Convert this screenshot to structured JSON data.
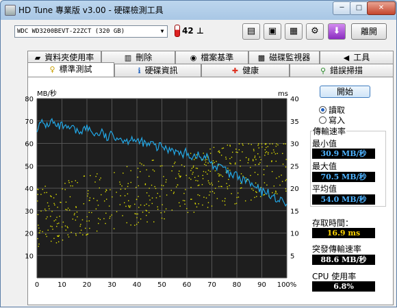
{
  "window": {
    "title": "HD Tune 專業版 v3.00 - 硬碟檢測工具",
    "min_label": "─",
    "max_label": "□",
    "close_label": "✕"
  },
  "toolbar": {
    "drive": "WDC WD3200BEVT-22ZCT (320 GB)",
    "temperature": "42 ⊥",
    "exit_label": "離開",
    "buttons": [
      {
        "icon": "copy-text-icon",
        "glyph": "▤"
      },
      {
        "icon": "copy-screenshot-icon",
        "glyph": "▣"
      },
      {
        "icon": "save-icon",
        "glyph": "▦"
      },
      {
        "icon": "options-icon",
        "glyph": "⚙"
      },
      {
        "icon": "download-icon",
        "glyph": "⬇"
      }
    ]
  },
  "tabs_top": [
    {
      "label": "資料夾使用率",
      "icon": "folder-icon",
      "glyph": "▰"
    },
    {
      "label": "刪除",
      "icon": "trash-icon",
      "glyph": "▥"
    },
    {
      "label": "檔案基準",
      "icon": "file-benchmark-icon",
      "glyph": "◉"
    },
    {
      "label": "磁碟監視器",
      "icon": "disk-monitor-icon",
      "glyph": "▩"
    },
    {
      "label": "工具",
      "icon": "speaker-icon",
      "glyph": "◀"
    }
  ],
  "tabs_bottom": [
    {
      "label": "標準測試",
      "icon": "bulb-icon",
      "glyph": "♀",
      "active": true
    },
    {
      "label": "硬碟資訊",
      "icon": "info-icon",
      "glyph": "ℹ",
      "active": false
    },
    {
      "label": "健康",
      "icon": "health-cross-icon",
      "glyph": "✚",
      "active": false
    },
    {
      "label": "錯誤掃描",
      "icon": "magnifier-icon",
      "glyph": "⚲",
      "active": false
    }
  ],
  "controls": {
    "start_label": "開始",
    "read_label": "讀取",
    "write_label": "寫入",
    "selected_mode": "read"
  },
  "stats": {
    "transfer_rate_heading": "傳輸速率",
    "min_label": "最小值",
    "min_value": "30.9 MB/秒",
    "max_label": "最大值",
    "max_value": "70.5 MB/秒",
    "avg_label": "平均值",
    "avg_value": "54.0 MB/秒",
    "access_label": "存取時間：",
    "access_value": "16.9 ms",
    "burst_label": "突發傳輸速率",
    "burst_value": "88.6 MB/秒",
    "cpu_label": "CPU 使用率",
    "cpu_value": "6.8%"
  },
  "chart_data": {
    "type": "line",
    "ylabel": "MB/秒",
    "y2label": "ms",
    "ylim": [
      0,
      80
    ],
    "y2lim": [
      0,
      40
    ],
    "y_ticks": [
      "80",
      "70",
      "60",
      "50",
      "40",
      "30",
      "20",
      "10"
    ],
    "y2_ticks": [
      "40",
      "35",
      "30",
      "25",
      "20",
      "15",
      "10",
      "5"
    ],
    "x_ticks": [
      "0",
      "10",
      "20",
      "30",
      "40",
      "50",
      "60",
      "70",
      "80",
      "90",
      "100%"
    ],
    "xlim": [
      0,
      100
    ],
    "grid": true,
    "colors": {
      "transfer": "#22a7e6",
      "access": "#e6e600",
      "background": "#1e1e1e",
      "grid": "#555555"
    },
    "transfer_series": {
      "name": "transfer rate",
      "x": [
        0,
        2,
        4,
        6,
        8,
        10,
        12,
        14,
        16,
        18,
        20,
        22,
        24,
        26,
        28,
        30,
        32,
        34,
        36,
        38,
        40,
        42,
        44,
        46,
        48,
        50,
        52,
        54,
        56,
        58,
        60,
        62,
        64,
        66,
        68,
        70,
        72,
        74,
        76,
        78,
        80,
        82,
        84,
        86,
        88,
        90,
        92,
        94,
        96,
        98,
        100
      ],
      "values": [
        67,
        69,
        68,
        70,
        67,
        68,
        66,
        67,
        65,
        66,
        67,
        65,
        64,
        65,
        62,
        64,
        63,
        62,
        61,
        63,
        60,
        61,
        59,
        60,
        58,
        59,
        57,
        58,
        56,
        55,
        56,
        54,
        55,
        53,
        54,
        51,
        49,
        50,
        47,
        45,
        46,
        43,
        44,
        41,
        40,
        38,
        39,
        36,
        35,
        34,
        33
      ]
    },
    "access_series": {
      "name": "access time",
      "seed": 7,
      "count": 520,
      "min_ms": 5,
      "max_ms": 30,
      "trend": [
        14,
        26
      ]
    }
  }
}
